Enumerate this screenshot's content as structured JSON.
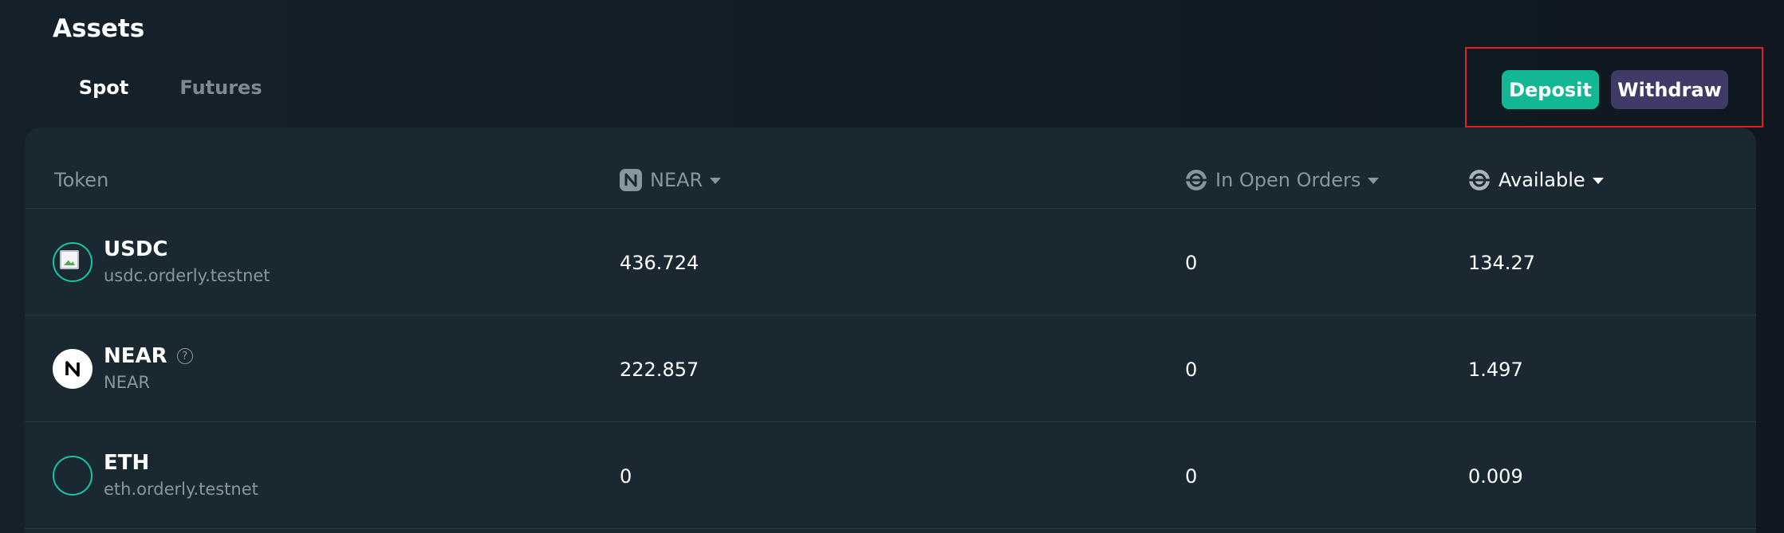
{
  "page": {
    "title": "Assets"
  },
  "tabs": [
    {
      "label": "Spot",
      "active": true
    },
    {
      "label": "Futures",
      "active": false
    }
  ],
  "actions": {
    "deposit_label": "Deposit",
    "withdraw_label": "Withdraw"
  },
  "table": {
    "headers": {
      "token": "Token",
      "near": "NEAR",
      "in_open_orders": "In Open Orders",
      "available": "Available"
    },
    "rows": [
      {
        "symbol": "USDC",
        "sub": "usdc.orderly.testnet",
        "near": "436.724",
        "in_open_orders": "0",
        "available": "134.27",
        "icon": "broken-image-icon"
      },
      {
        "symbol": "NEAR",
        "sub": "NEAR",
        "near": "222.857",
        "in_open_orders": "0",
        "available": "1.497",
        "icon": "near-logo-icon"
      },
      {
        "symbol": "ETH",
        "sub": "eth.orderly.testnet",
        "near": "0",
        "in_open_orders": "0",
        "available": "0.009",
        "icon": "eth-token-icon"
      }
    ]
  },
  "colors": {
    "accent": "#16c5a4",
    "deposit": "#12b894",
    "withdraw": "#3f3b66",
    "highlight_box": "#e3201b"
  }
}
